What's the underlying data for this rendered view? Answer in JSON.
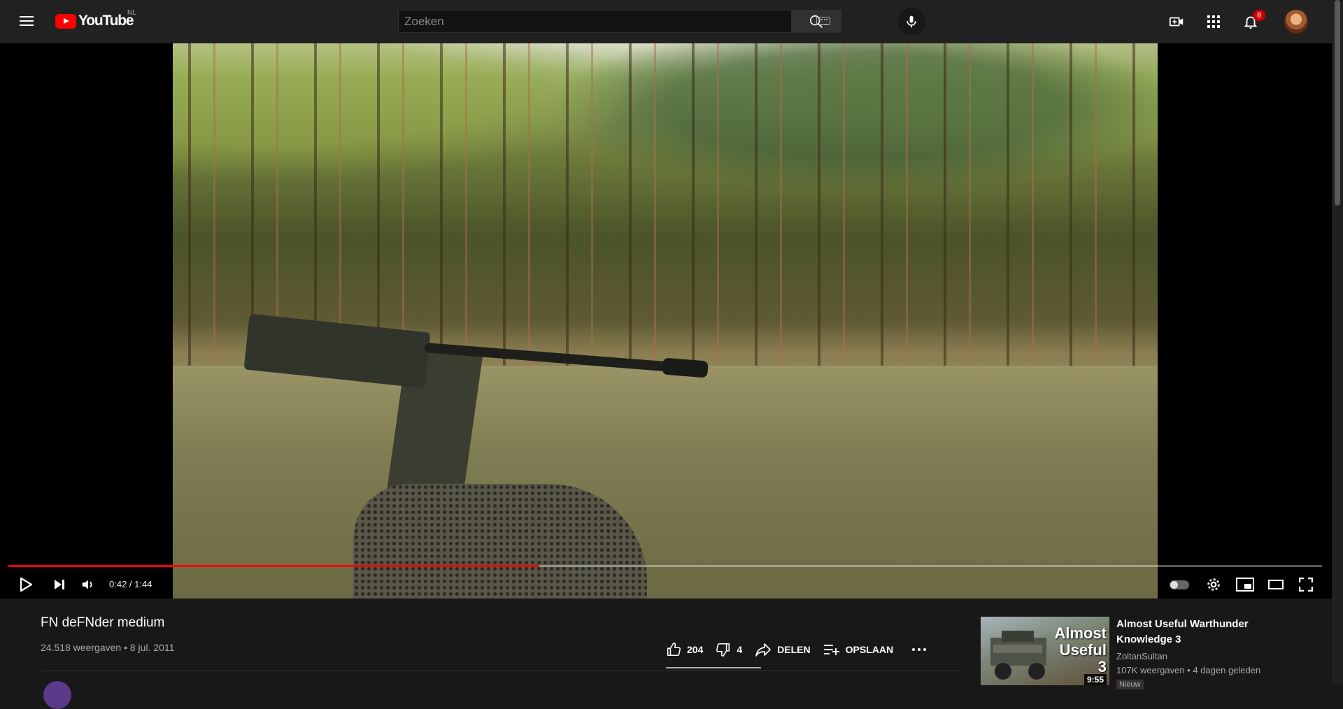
{
  "header": {
    "logo_text": "YouTube",
    "country_code": "NL",
    "search_placeholder": "Zoeken",
    "notification_count": "8"
  },
  "player": {
    "current_time": "0:42",
    "duration": "1:44",
    "time_display": "0:42 / 1:44",
    "progress_fraction": 0.404
  },
  "video": {
    "title": "FN deFNder medium",
    "views": "24.518 weergaven",
    "date": "8 jul. 2011",
    "meta": "24.518 weergaven • 8 jul. 2011",
    "likes": "204",
    "dislikes": "4",
    "share_label": "DELEN",
    "save_label": "OPSLAAN",
    "more_label": "..."
  },
  "recommendation": {
    "thumb_text": "Almost Useful 3",
    "duration": "9:55",
    "title": "Almost Useful Warthunder Knowledge 3",
    "channel": "ZoltanSultan",
    "meta": "107K weergaven • 4 dagen geleden",
    "badge": "Nieuw"
  },
  "colors": {
    "accent": "#ff0000",
    "header_bg": "#212121",
    "page_bg": "#181818"
  }
}
